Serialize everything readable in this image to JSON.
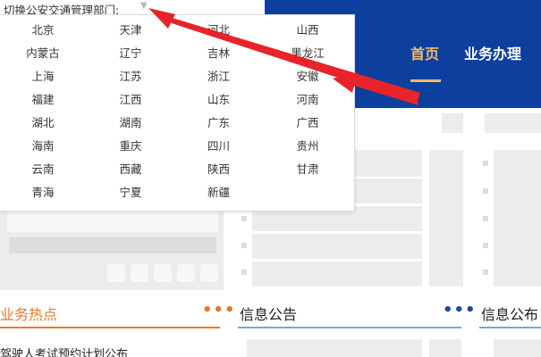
{
  "switcher": {
    "label": "切换公安交通管理部门:",
    "caret_icon": "caret-down-icon"
  },
  "provinces": [
    "北京",
    "天津",
    "河北",
    "山西",
    "内蒙古",
    "辽宁",
    "吉林",
    "黑龙江",
    "上海",
    "江苏",
    "浙江",
    "安徽",
    "福建",
    "江西",
    "山东",
    "河南",
    "湖北",
    "湖南",
    "广东",
    "广西",
    "海南",
    "重庆",
    "四川",
    "贵州",
    "云南",
    "西藏",
    "陕西",
    "甘肃",
    "青海",
    "宁夏",
    "新疆"
  ],
  "nav": {
    "home": "首页",
    "business": "业务办理"
  },
  "sections": {
    "hot": "业务热点",
    "notice": "信息公告",
    "notice2": "信息公布"
  },
  "more_label": "•••",
  "news": {
    "first": "驾驶人考试预约计划公布"
  },
  "colors": {
    "banner": "#0d3f9e",
    "accent_orange": "#e67a25",
    "nav_active": "#f4b968",
    "arrow_red": "#e8242a",
    "more_blue": "#1c4a9e"
  }
}
